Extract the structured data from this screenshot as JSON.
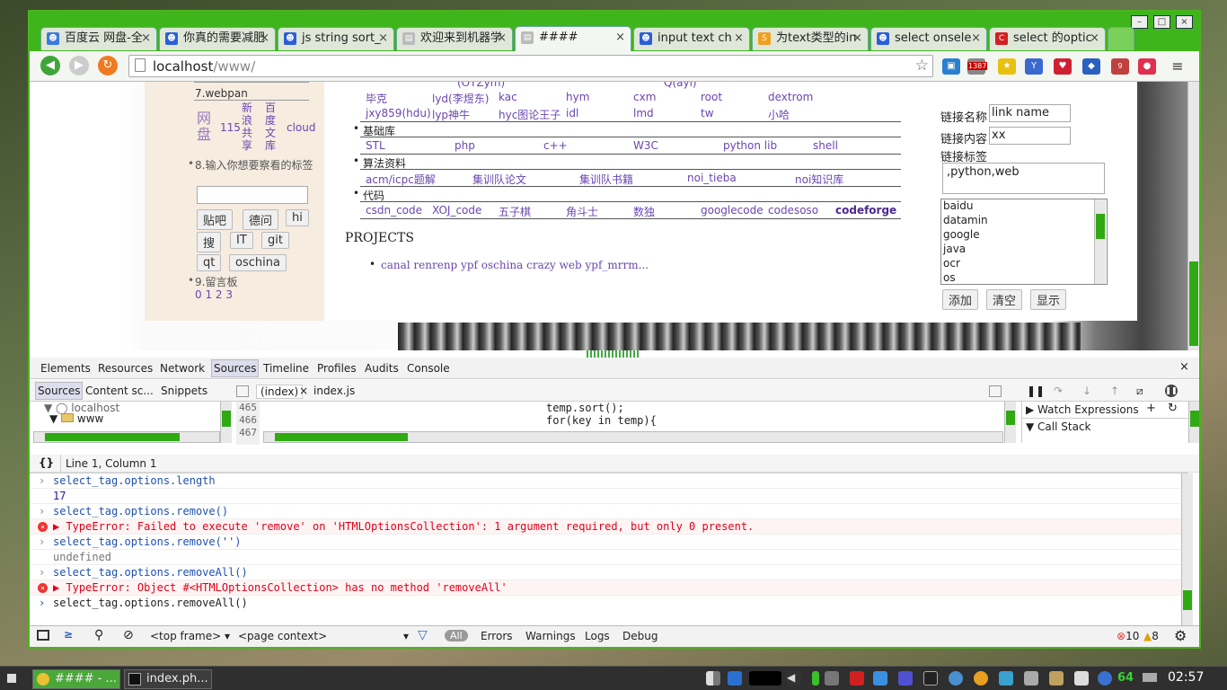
{
  "tabs": [
    {
      "label": "百度云 网盘-全",
      "icon_color": "#3b7ae0",
      "icon": "paw-icon"
    },
    {
      "label": "你真的需要减肥",
      "icon_color": "#2b5fd9",
      "icon": "paw-icon"
    },
    {
      "label": "js string sort_",
      "icon_color": "#2b5fd9",
      "icon": "paw-icon"
    },
    {
      "label": "欢迎来到机器学",
      "icon_color": "#bbbbbb",
      "icon": "page-icon"
    },
    {
      "label": "####",
      "icon_color": "#bbbbbb",
      "icon": "page-icon"
    },
    {
      "label": "input text ch",
      "icon_color": "#2b5fd9",
      "icon": "paw-icon"
    },
    {
      "label": "为text类型的in",
      "icon_color": "#f0a020",
      "icon": "search-s-icon"
    },
    {
      "label": "select onsele",
      "icon_color": "#2b5fd9",
      "icon": "paw-icon"
    },
    {
      "label": "select 的optic",
      "icon_color": "#d02020",
      "icon": "csdn-c-icon"
    }
  ],
  "window_controls": {
    "min": "–",
    "max": "□",
    "close": "×"
  },
  "url": {
    "host": "localhost",
    "path": "/www/"
  },
  "ext_badges": {
    "mail": "1387",
    "counter": "9"
  },
  "left": {
    "s7": "7.webpan",
    "webpan": [
      "网盘",
      "115",
      "新浪共享",
      "百度文库",
      "cloud"
    ],
    "s8": "8.输入你想要察看的标签",
    "tags": [
      "贴吧",
      "德问",
      "hi",
      "搜",
      "IT",
      "git",
      "qt",
      "oschina"
    ],
    "s9": "9.留言板",
    "pages": "0 1 2 3"
  },
  "content": {
    "top_partial": [
      "(OTZym)",
      "Q(ayi)"
    ],
    "people_row1": [
      "毕克",
      "lyd(李煜东)",
      "kac",
      "hym",
      "cxm",
      "root",
      "dextrom"
    ],
    "people_row2": [
      "jxy859(hdu)",
      "lyp神牛",
      "hyc图论王子",
      "idl",
      "lmd",
      "tw",
      "小哈"
    ],
    "sec_base": "基础库",
    "base": [
      "STL",
      "php",
      "c++",
      "W3C",
      "python lib",
      "shell"
    ],
    "sec_algo": "算法资料",
    "algo": [
      "acm/icpc题解",
      "集训队论文",
      "集训队书籍",
      "noi_tieba",
      "noi知识库"
    ],
    "sec_code": "代码",
    "code": [
      "csdn_code",
      "XOJ_code",
      "五子棋",
      "角斗士",
      "数独",
      "googlecode",
      "codesoso",
      "codeforge"
    ],
    "projects_title": "PROJECTS",
    "projects": "canal renrenp ypf oschina crazy web ypf_mrrm..."
  },
  "form": {
    "name_label": "链接名称",
    "name_value": "link name",
    "content_label": "链接内容",
    "content_value": "xx",
    "tags_label": "链接标签",
    "tags_value": ",python,web",
    "options": [
      "baidu",
      "datamin",
      "google",
      "java",
      "ocr",
      "os"
    ],
    "add": "添加",
    "clear": "清空",
    "show": "显示"
  },
  "devtools": {
    "tabs": [
      "Elements",
      "Resources",
      "Network",
      "Sources",
      "Timeline",
      "Profiles",
      "Audits",
      "Console"
    ],
    "nav_tabs": [
      "Sources",
      "Content sc...",
      "Snippets"
    ],
    "tree": [
      "localhost",
      "www"
    ],
    "file_tabs": [
      "(index)",
      "index.js"
    ],
    "lines": [
      "465",
      "466",
      "467"
    ],
    "code": [
      "temp.sort();",
      "for(key in temp){"
    ],
    "panel": [
      "Watch Expressions",
      "Call Stack"
    ],
    "position": "Line 1, Column 1",
    "console": [
      {
        "kind": "in",
        "text": "select_tag.options.length"
      },
      {
        "kind": "out",
        "text": "17"
      },
      {
        "kind": "in",
        "text": "select_tag.options.remove()"
      },
      {
        "kind": "err",
        "text": "TypeError: Failed to execute 'remove' on 'HTMLOptionsCollection': 1 argument required, but only 0 present."
      },
      {
        "kind": "in",
        "text": "select_tag.options.remove('')"
      },
      {
        "kind": "gray",
        "text": "undefined"
      },
      {
        "kind": "in",
        "text": "select_tag.options.removeAll()"
      },
      {
        "kind": "err",
        "text": "TypeError: Object #<HTMLOptionsCollection> has no method 'removeAll'"
      }
    ],
    "prompt": "select_tag.options.removeAll()",
    "bar": {
      "frame": "<top frame>",
      "context": "<page context>",
      "all": "All",
      "errors": "Errors",
      "warnings": "Warnings",
      "logs": "Logs",
      "debug": "Debug",
      "err_count": "10",
      "warn_count": "8"
    }
  },
  "taskbar": {
    "items": [
      "#### - ...",
      "index.ph..."
    ],
    "tray_count": "64",
    "clock": "02:57"
  }
}
